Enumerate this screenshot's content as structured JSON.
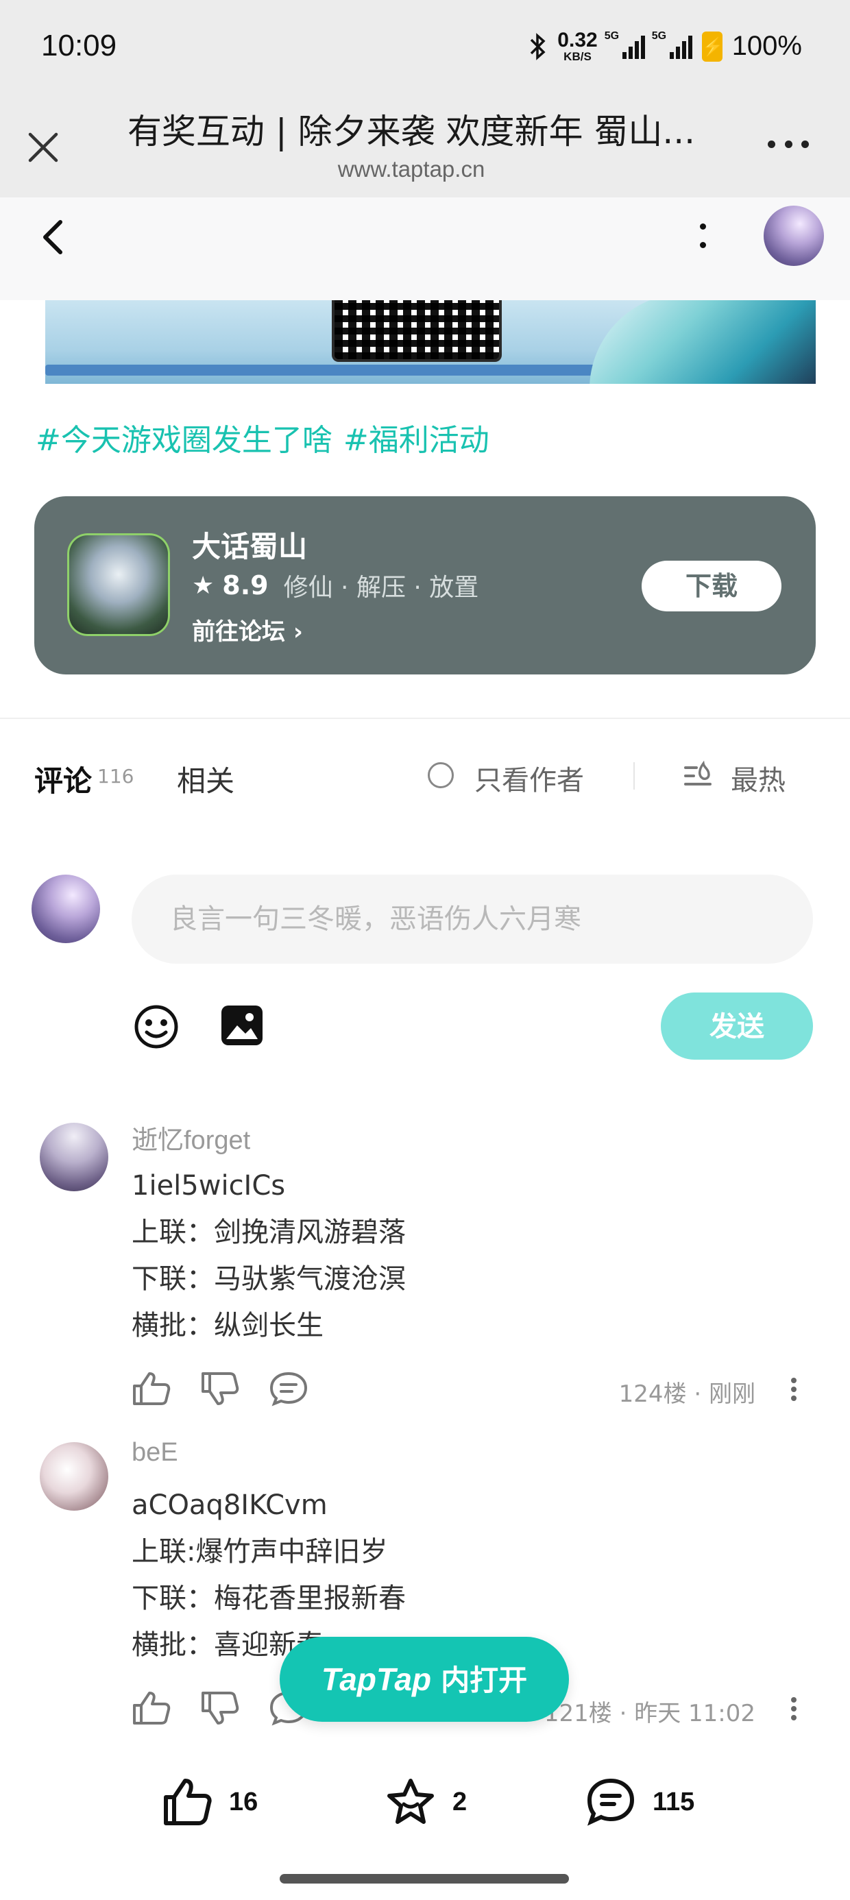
{
  "status_bar": {
    "time": "10:09",
    "net_speed": "0.32",
    "net_unit": "KB/S",
    "sig1_tag": "5G",
    "sig2_tag": "5G",
    "battery": "100%"
  },
  "browser": {
    "title": "有奖互动 | 除夕来袭 欢度新年 蜀山...",
    "url": "www.taptap.cn"
  },
  "post": {
    "hashtags": [
      "#今天游戏圈发生了啥",
      "#福利活动"
    ]
  },
  "game": {
    "name": "大话蜀山",
    "rating": "8.9",
    "tags": "修仙 · 解压 · 放置",
    "forum_link": "前往论坛",
    "download_label": "下载"
  },
  "tabs": {
    "comments_label": "评论",
    "comments_count": "116",
    "related_label": "相关",
    "author_only_label": "只看作者",
    "sort_label": "最热"
  },
  "composer": {
    "placeholder": "良言一句三冬暖，恶语伤人六月寒",
    "send_label": "发送"
  },
  "comments": [
    {
      "author": "逝忆forget",
      "lines": [
        "1iel5wicICs",
        "上联：剑挽清风游碧落",
        "下联：马驮紫气渡沧溟",
        "横批：纵剑长生"
      ],
      "meta": "124楼 · 刚刚"
    },
    {
      "author": "beE",
      "lines": [
        "aCOaq8IKCvm",
        "上联:爆竹声中辞旧岁",
        "下联：梅花香里报新春",
        "横批：喜迎新春"
      ],
      "meta": "121楼 · 昨天 11:02"
    }
  ],
  "open_app": {
    "brand": "TapTap",
    "label": "内打开"
  },
  "bottom_bar": {
    "likes": "16",
    "favorites": "2",
    "comments": "115"
  },
  "colors": {
    "accent": "#14c5b3",
    "hashtag": "#19c2b0",
    "card_bg": "#627070",
    "send_disabled": "#7fe3dc"
  }
}
